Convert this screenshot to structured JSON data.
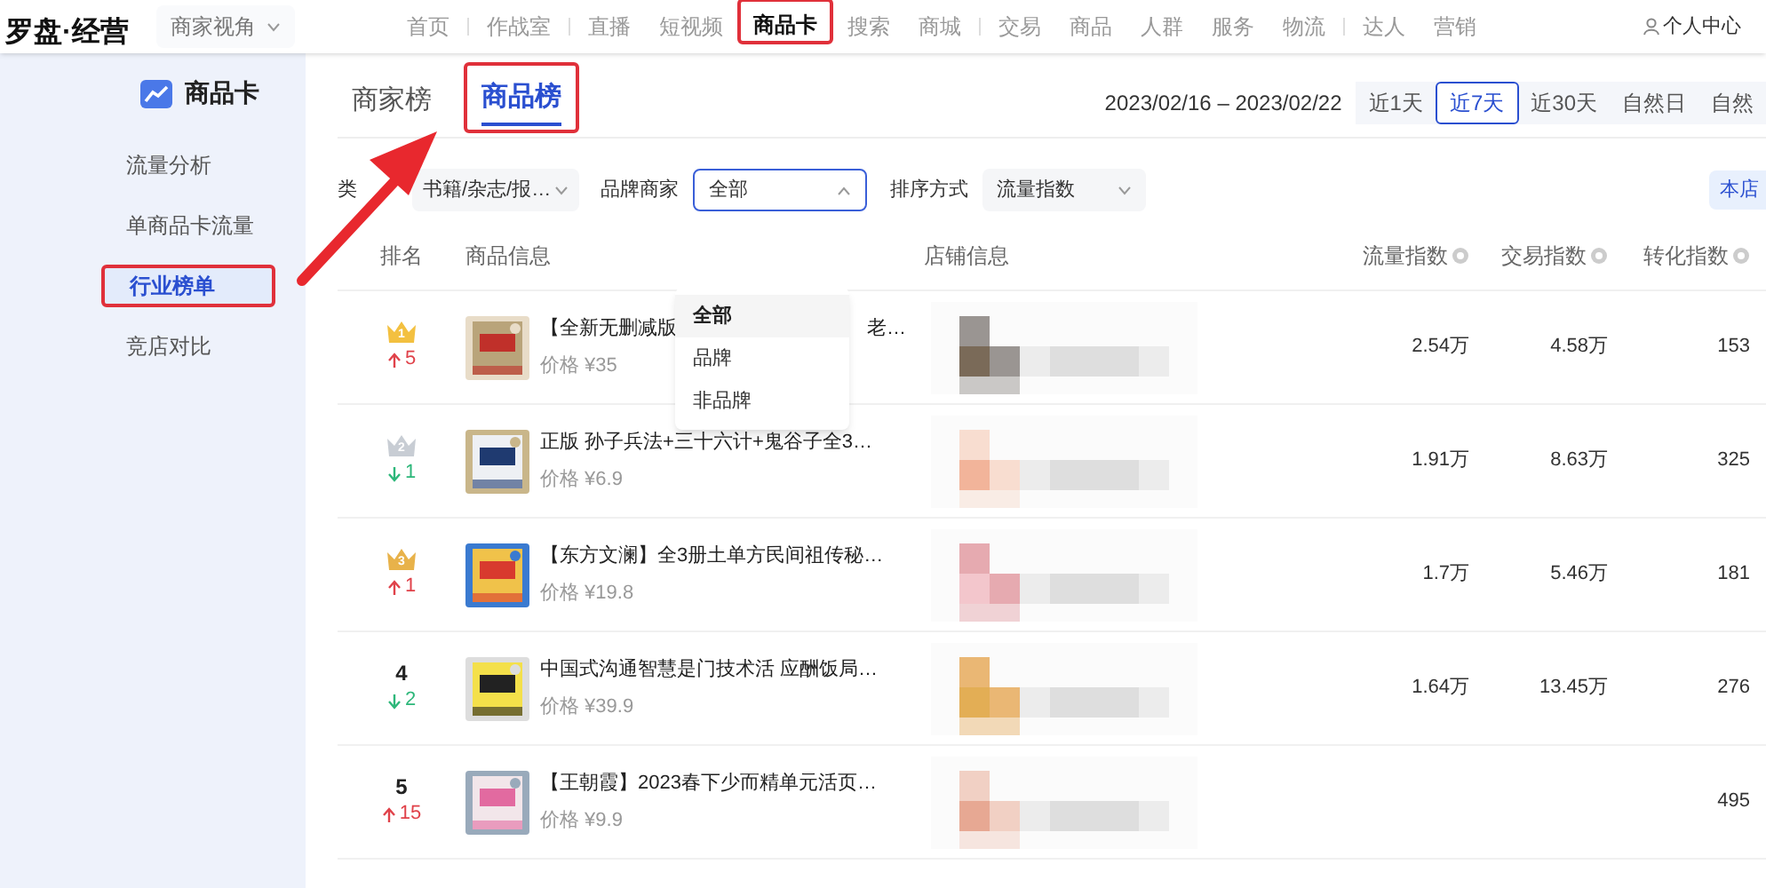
{
  "logo": "罗盘·经营",
  "view_switch": {
    "label": "商家视角"
  },
  "nav": [
    {
      "label": "首页",
      "selected": false,
      "highlighted": false,
      "divider_after": true
    },
    {
      "label": "作战室",
      "selected": false,
      "highlighted": false,
      "divider_after": true
    },
    {
      "label": "直播",
      "selected": false,
      "highlighted": false,
      "divider_after": false
    },
    {
      "label": "短视频",
      "selected": false,
      "highlighted": false,
      "divider_after": false
    },
    {
      "label": "商品卡",
      "selected": true,
      "highlighted": true,
      "divider_after": false
    },
    {
      "label": "搜索",
      "selected": false,
      "highlighted": false,
      "divider_after": false
    },
    {
      "label": "商城",
      "selected": false,
      "highlighted": false,
      "divider_after": true
    },
    {
      "label": "交易",
      "selected": false,
      "highlighted": false,
      "divider_after": false
    },
    {
      "label": "商品",
      "selected": false,
      "highlighted": false,
      "divider_after": false
    },
    {
      "label": "人群",
      "selected": false,
      "highlighted": false,
      "divider_after": false
    },
    {
      "label": "服务",
      "selected": false,
      "highlighted": false,
      "divider_after": false
    },
    {
      "label": "物流",
      "selected": false,
      "highlighted": false,
      "divider_after": true
    },
    {
      "label": "达人",
      "selected": false,
      "highlighted": false,
      "divider_after": false
    },
    {
      "label": "营销",
      "selected": false,
      "highlighted": false,
      "divider_after": false
    }
  ],
  "account": {
    "label": "个人中心"
  },
  "sidebar": {
    "title": "商品卡",
    "items": [
      {
        "label": "流量分析",
        "selected": false,
        "highlighted": false
      },
      {
        "label": "单商品卡流量",
        "selected": false,
        "highlighted": false
      },
      {
        "label": "行业榜单",
        "selected": true,
        "highlighted": true
      },
      {
        "label": "竞店对比",
        "selected": false,
        "highlighted": false
      }
    ]
  },
  "tabs": [
    {
      "label": "商家榜",
      "selected": false,
      "highlighted": false
    },
    {
      "label": "商品榜",
      "selected": true,
      "highlighted": true
    }
  ],
  "date_range": "2023/02/16 – 2023/02/22",
  "periods": [
    {
      "label": "近1天",
      "selected": false
    },
    {
      "label": "近7天",
      "selected": true
    },
    {
      "label": "近30天",
      "selected": false
    },
    {
      "label": "自然日",
      "selected": false
    },
    {
      "label": "自然",
      "selected": false
    }
  ],
  "filters": {
    "category_label": "类",
    "category_value": "书籍/杂志/报…",
    "brand_label": "品牌商家",
    "brand_value": "全部",
    "brand_open": true,
    "brand_options": [
      {
        "label": "全部",
        "selected": true
      },
      {
        "label": "品牌",
        "selected": false
      },
      {
        "label": "非品牌",
        "selected": false
      }
    ],
    "sort_label": "排序方式",
    "sort_value": "流量指数",
    "store_button": "本店"
  },
  "table": {
    "columns": [
      "排名",
      "商品信息",
      "店铺信息",
      "流量指数",
      "交易指数",
      "转化指数"
    ],
    "rows": [
      {
        "rank": "1",
        "kind": "crown",
        "color": "#f3c040",
        "rising": true,
        "change": "5",
        "title": "【全新无删减版",
        "title_end": "老…",
        "price": "价格 ¥35",
        "traffic": "2.54万",
        "trade": "4.58万",
        "conversion": "153"
      },
      {
        "rank": "2",
        "kind": "crown",
        "color": "#c8cdd4",
        "rising": false,
        "change": "1",
        "title": "正版 孙子兵法+三十六计+鬼谷子全3…",
        "price": "价格 ¥6.9",
        "traffic": "1.91万",
        "trade": "8.63万",
        "conversion": "325"
      },
      {
        "rank": "3",
        "kind": "crown",
        "color": "#e8b24a",
        "rising": true,
        "change": "1",
        "title": "【东方文澜】全3册土单方民间祖传秘…",
        "price": "价格 ¥19.8",
        "traffic": "1.7万",
        "trade": "5.46万",
        "conversion": "181"
      },
      {
        "rank": "4",
        "kind": "plain",
        "rising": false,
        "change": "2",
        "title": "中国式沟通智慧是门技术活 应酬饭局…",
        "price": "价格 ¥39.9",
        "traffic": "1.64万",
        "trade": "13.45万",
        "conversion": "276"
      },
      {
        "rank": "5",
        "kind": "plain",
        "rising": true,
        "change": "15",
        "title": "【王朝霞】2023春下少而精单元活页…",
        "price": "价格 ¥9.9",
        "conversion": "495"
      }
    ]
  }
}
